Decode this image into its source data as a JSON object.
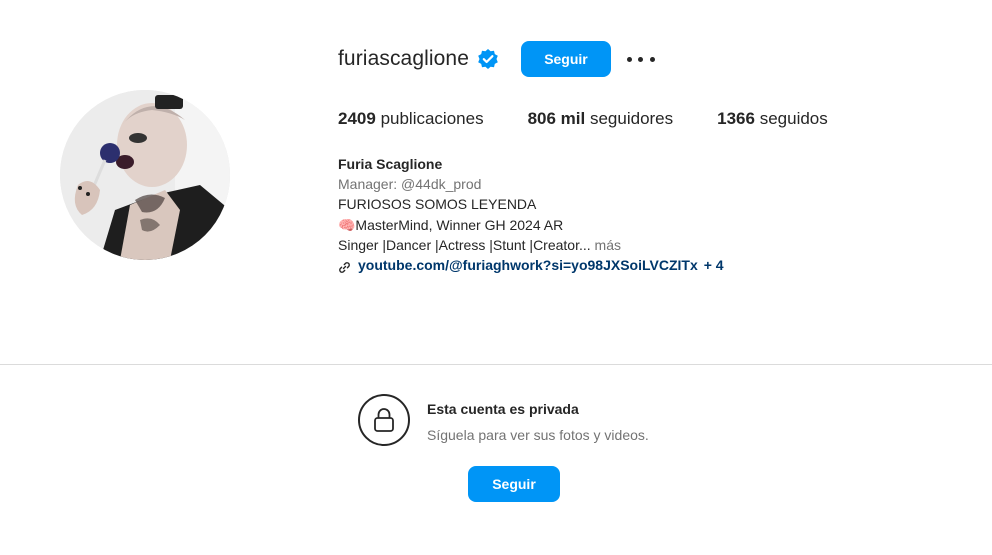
{
  "profile": {
    "username": "furiascaglione",
    "follow_label": "Seguir",
    "stats": {
      "posts_count": "2409",
      "posts_label": "publicaciones",
      "followers_count": "806 mil",
      "followers_label": "seguidores",
      "following_count": "1366",
      "following_label": "seguidos"
    },
    "bio": {
      "name": "Furia Scaglione",
      "manager": "Manager: @44dk_prod",
      "line2": "FURIOSOS SOMOS LEYENDA",
      "line3": "🧠MasterMind, Winner GH 2024 AR",
      "line4": "Singer |Dancer |Actress |Stunt |Creator...",
      "more_label": "más",
      "link": "youtube.com/@furiaghwork?si=yo98JXSoiLVCZITx",
      "link_extra": "+ 4"
    }
  },
  "private_section": {
    "title": "Esta cuenta es privada",
    "subtitle": "Síguela para ver sus fotos y videos.",
    "follow_label": "Seguir"
  },
  "icons": {
    "verified": "verified-badge-icon",
    "more": "more-options-icon",
    "link": "link-icon",
    "lock": "lock-icon"
  },
  "colors": {
    "accent": "#0095f6",
    "text": "#262626",
    "muted": "#737373",
    "link": "#00376b",
    "divider": "#dbdbdb"
  }
}
